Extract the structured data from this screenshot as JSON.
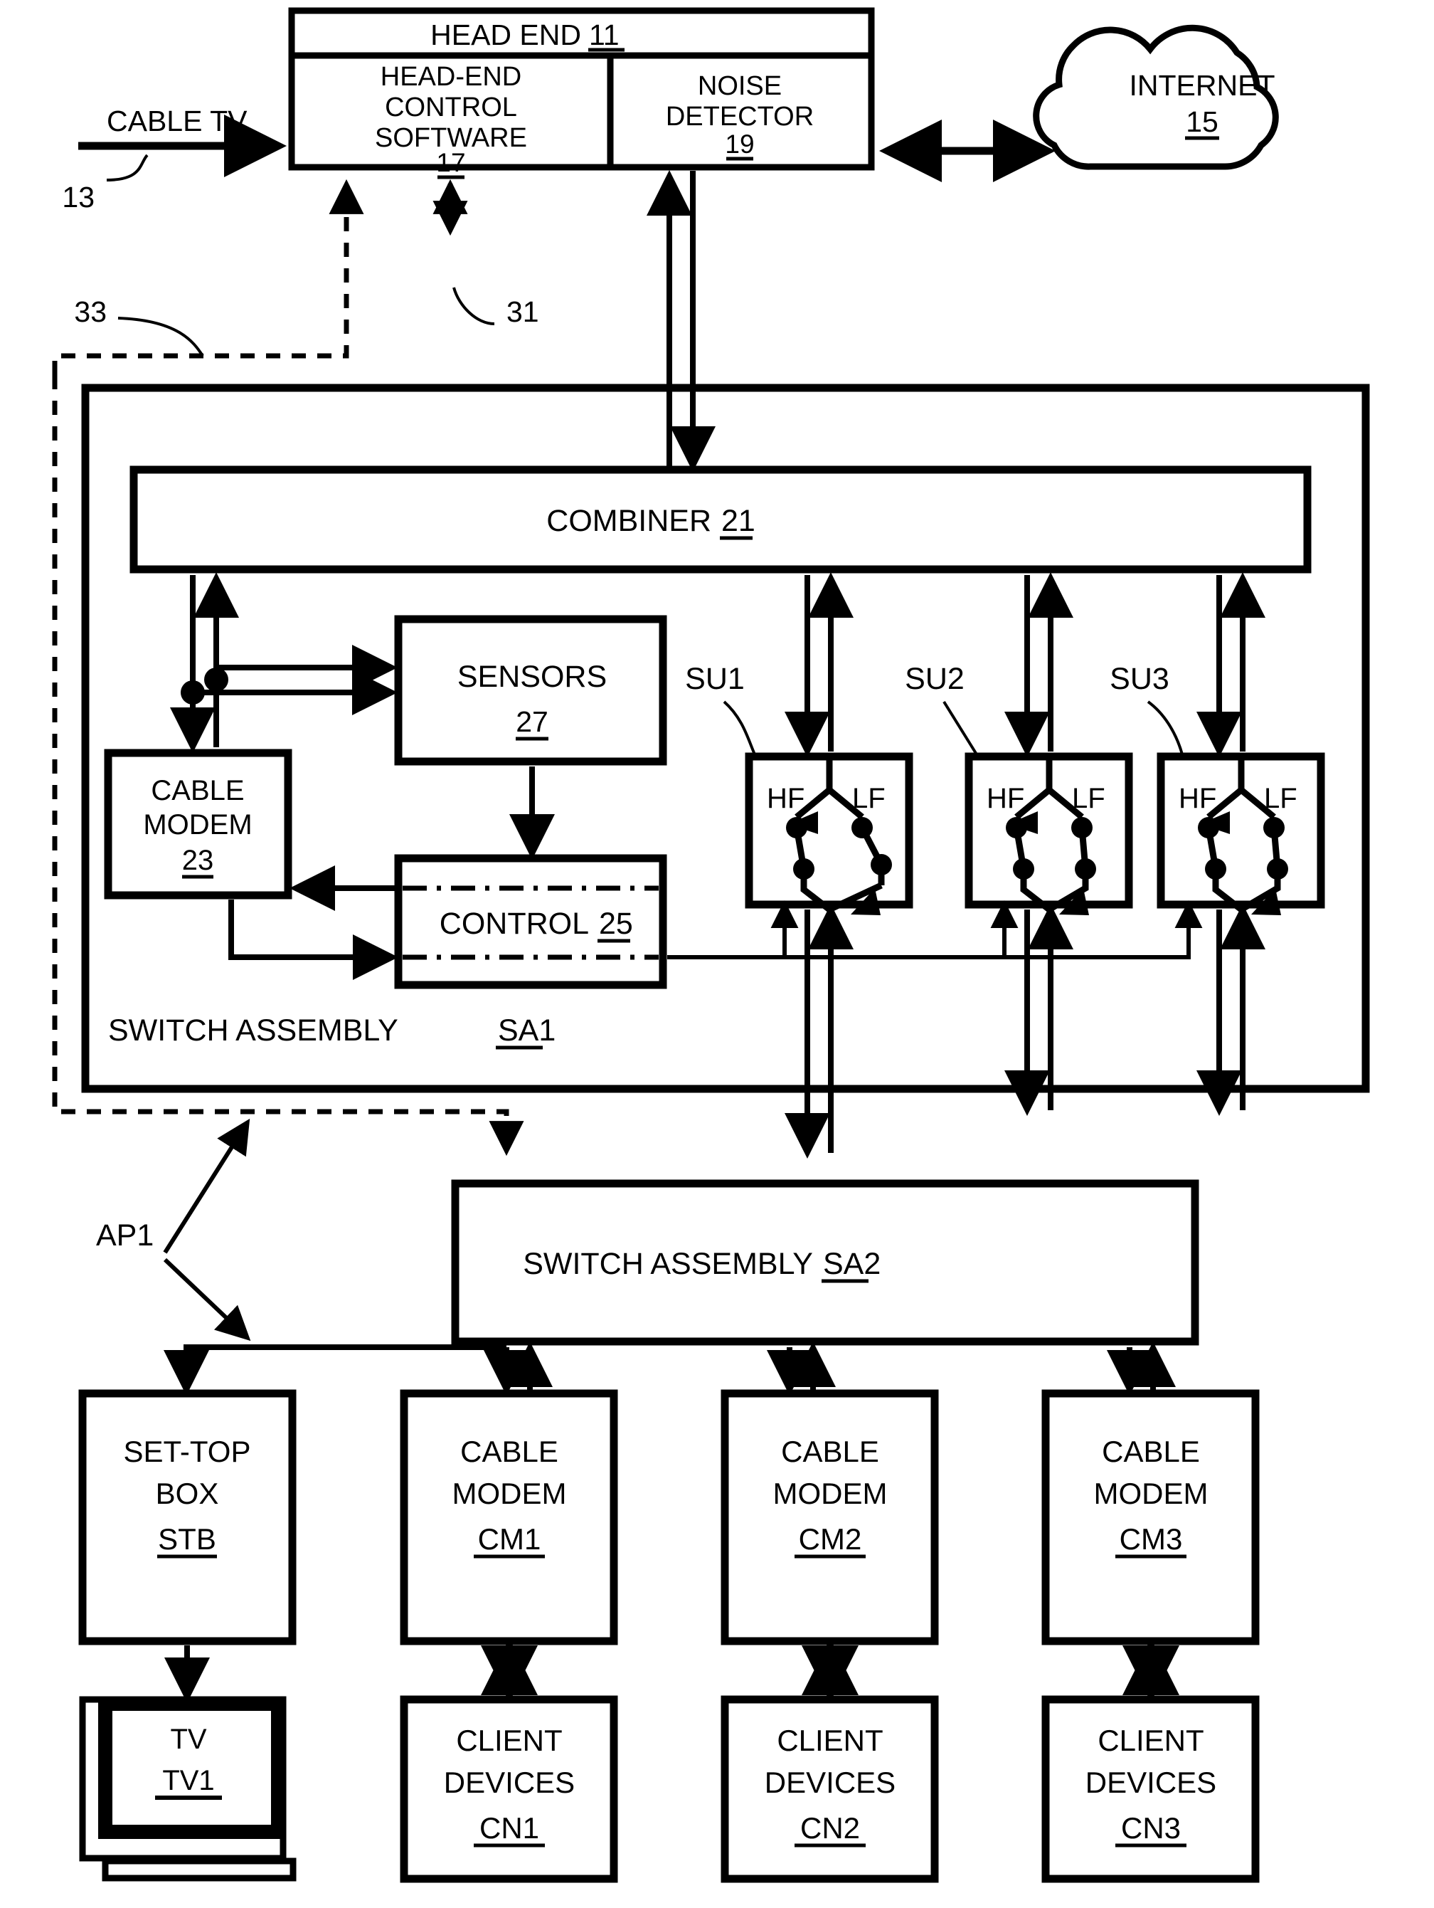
{
  "figure": {
    "type": "patent-block-diagram",
    "title": "Cable TV noise-detecting switch assembly network"
  },
  "blocks": {
    "head_end": {
      "title": "HEAD END",
      "ref": "11"
    },
    "head_end_control_software": {
      "line1": "HEAD-END",
      "line2": "CONTROL",
      "line3": "SOFTWARE",
      "ref": "17"
    },
    "noise_detector": {
      "line1": "NOISE",
      "line2": "DETECTOR",
      "ref": "19"
    },
    "internet": {
      "label": "INTERNET",
      "ref": "15"
    },
    "combiner": {
      "label": "COMBINER",
      "ref": "21"
    },
    "sensors": {
      "label": "SENSORS",
      "ref": "27"
    },
    "cable_modem_23": {
      "line1": "CABLE",
      "line2": "MODEM",
      "ref": "23"
    },
    "control": {
      "label": "CONTROL",
      "ref": "25"
    },
    "switch_assembly_sa1": {
      "label": "SWITCH ASSEMBLY",
      "ref": "SA1"
    },
    "switch_assembly_sa2": {
      "label": "SWITCH ASSEMBLY",
      "ref": "SA2"
    },
    "set_top_box": {
      "line1": "SET-TOP",
      "line2": "BOX",
      "ref": "STB"
    },
    "tv": {
      "label": "TV",
      "ref": "TV1"
    }
  },
  "switch_units": [
    {
      "name": "SU1",
      "port_high": "HF",
      "port_low": "LF"
    },
    {
      "name": "SU2",
      "port_high": "HF",
      "port_low": "LF"
    },
    {
      "name": "SU3",
      "port_high": "HF",
      "port_low": "LF"
    }
  ],
  "cable_modems": [
    {
      "line1": "CABLE",
      "line2": "MODEM",
      "ref": "CM1"
    },
    {
      "line1": "CABLE",
      "line2": "MODEM",
      "ref": "CM2"
    },
    {
      "line1": "CABLE",
      "line2": "MODEM",
      "ref": "CM3"
    }
  ],
  "client_devices": [
    {
      "line1": "CLIENT",
      "line2": "DEVICES",
      "ref": "CN1"
    },
    {
      "line1": "CLIENT",
      "line2": "DEVICES",
      "ref": "CN2"
    },
    {
      "line1": "CLIENT",
      "line2": "DEVICES",
      "ref": "CN3"
    }
  ],
  "callouts": {
    "cable_tv": "CABLE TV",
    "ref_13": "13",
    "ref_33": "33",
    "ref_31": "31",
    "ap1": "AP1"
  },
  "colors": {
    "stroke": "#000000",
    "fill": "#ffffff"
  }
}
